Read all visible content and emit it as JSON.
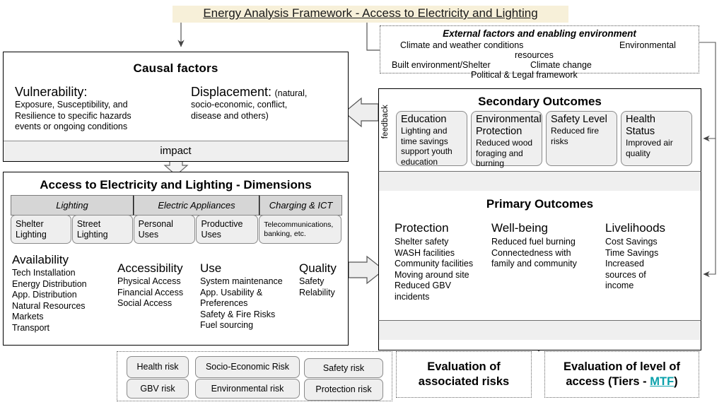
{
  "title": "Energy Analysis Framework - Access to Electricity and Lighting",
  "external": {
    "heading": "External factors and enabling environment",
    "items": [
      "Climate and weather conditions",
      "Environmental",
      "resources",
      "Built environment/Shelter",
      "Climate change",
      "Political & Legal framework"
    ]
  },
  "causal": {
    "heading": "Causal factors",
    "columns": [
      {
        "title": "Vulnerability:",
        "paren": "",
        "lines": [
          "Exposure, Susceptibility, and",
          "Resilience to specific hazards",
          "events or ongoing conditions"
        ]
      },
      {
        "title": "Displacement:",
        "paren": "(natural,",
        "lines": [
          "socio-economic, conflict,",
          "disease and others)"
        ]
      }
    ],
    "impact_label": "impact"
  },
  "dimensions": {
    "heading": "Access to Electricity and Lighting - Dimensions",
    "groups": [
      {
        "label": "Lighting",
        "subs": [
          "Shelter Lighting",
          "Street Lighting"
        ]
      },
      {
        "label": "Electric Appliances",
        "subs": [
          "Personal Uses",
          "Productive Uses"
        ]
      },
      {
        "label": "Charging & ICT",
        "subs": [
          "Telecommunications, banking, etc."
        ]
      }
    ],
    "columns": [
      {
        "title": "Availability",
        "lines": [
          "Tech Installation",
          "Energy Distribution",
          "App. Distribution",
          "Natural Resources",
          "Markets",
          "Transport"
        ]
      },
      {
        "title": "Accessibility",
        "lines": [
          "Physical Access",
          "Financial Access",
          "Social Access"
        ]
      },
      {
        "title": "Use",
        "lines": [
          "System maintenance",
          "App. Usability &",
          "Preferences",
          "Safety & Fire Risks",
          "Fuel sourcing"
        ]
      },
      {
        "title": "Quality",
        "lines": [
          "Safety",
          "Relability"
        ]
      }
    ]
  },
  "secondary": {
    "heading": "Secondary Outcomes",
    "feedback_label": "feedback",
    "cards": [
      {
        "title": "Education",
        "desc": "Lighting and time savings support youth education"
      },
      {
        "title": "Environmental Protection",
        "desc": "Reduced wood foraging and burning"
      },
      {
        "title": "Safety Level",
        "desc": "Reduced fire risks"
      },
      {
        "title": "Health Status",
        "desc": "Improved air quality"
      }
    ]
  },
  "primary": {
    "heading": "Primary Outcomes",
    "columns": [
      {
        "title": "Protection",
        "lines": [
          "Shelter safety",
          "WASH facilities",
          "Community facilities",
          "Moving around site",
          "Reduced GBV",
          "incidents"
        ]
      },
      {
        "title": "Well-being",
        "lines": [
          "Reduced fuel burning",
          "Connectedness with",
          "family and community"
        ]
      },
      {
        "title": "Livelihoods",
        "lines": [
          "Cost Savings",
          "Time Savings",
          "Increased",
          "sources of",
          "income"
        ]
      }
    ]
  },
  "risks": {
    "items": [
      "Health risk",
      "Socio-Economic Risk",
      "Safety risk",
      "GBV risk",
      "Environmental risk",
      "Protection risk"
    ]
  },
  "evaluation": {
    "risks_label": "Evaluation of associated risks",
    "access_prefix": "Evaluation of level of access (Tiers - ",
    "access_link": "MTF",
    "access_suffix": ")"
  },
  "colors": {
    "title_highlight": "#f7f0d9",
    "panel_gray": "#efefef",
    "header_gray": "#d6d6d6",
    "link_teal": "#0aa1ab",
    "outline": "#000000"
  }
}
